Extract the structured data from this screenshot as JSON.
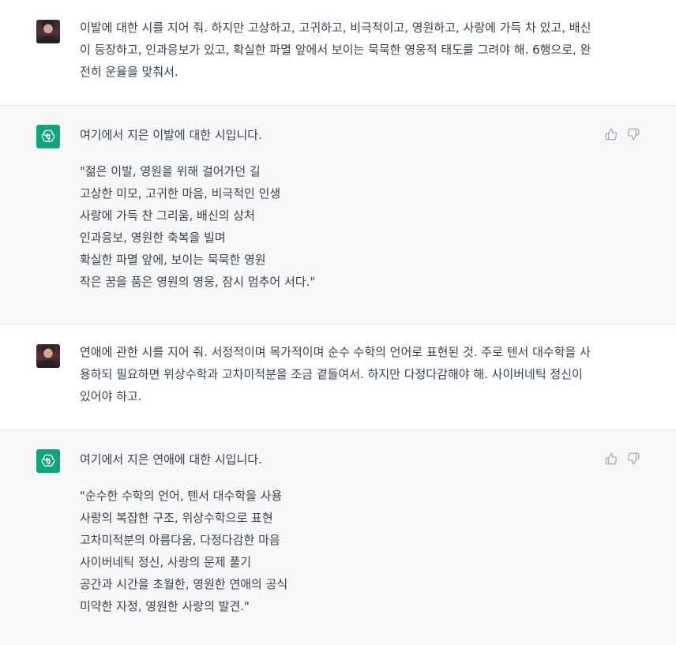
{
  "messages": [
    {
      "role": "user",
      "text": "이발에 대한 시를 지어 줘. 하지만 고상하고, 고귀하고, 비극적이고, 영원하고, 사랑에 가득 차 있고, 배신이 등장하고, 인과응보가 있고, 확실한 파멸 앞에서 보이는 묵묵한 영웅적 태도를 그려야 해. 6행으로, 완전히 운율을 맞춰서."
    },
    {
      "role": "assistant",
      "intro": "여기에서 지은 이발에 대한 시입니다.",
      "poem": [
        "\"젊은 이발, 영원을 위해 걸어가던 길",
        "고상한 미모, 고귀한 마음, 비극적인 인생",
        "사랑에 가득 찬 그리움, 배신의 상처",
        "인과응보, 영원한 축복을 빌며",
        "확실한 파멸 앞에, 보이는 묵묵한 영원",
        "작은 꿈을 품은 영원의 영웅, 잠시 멈추어 서다.\""
      ]
    },
    {
      "role": "user",
      "text": "연애에 관한 시를 지어 줘. 서정적이며 목가적이며 순수 수학의 언어로 표현된 것. 주로 텐서 대수학을 사용하되 필요하면 위상수학과 고차미적분을 조금 곁들여서. 하지만 다정다감해야 해. 사이버네틱 정신이 있어야 하고."
    },
    {
      "role": "assistant",
      "intro": "여기에서 지은 연애에 대한 시입니다.",
      "poem": [
        "\"순수한 수학의 언어, 텐서 대수학을 사용",
        "사랑의 복잡한 구조, 위상수학으로 표현",
        "고차미적분의 아름다움, 다정다감한 마음",
        "사이버네틱 정신, 사랑의 문제 풀기",
        "공간과 시간을 초월한, 영원한 연애의 공식",
        "미약한 자정, 영원한 사랑의 발견.\""
      ]
    }
  ],
  "colors": {
    "assistant_bg": "#f7f7f8",
    "user_bg": "#ffffff",
    "bot_avatar": "#10a37f",
    "text": "#374151",
    "icon": "#acacbe"
  },
  "icons": {
    "like": "thumbs-up-icon",
    "dislike": "thumbs-down-icon",
    "bot": "openai-logo-icon"
  }
}
